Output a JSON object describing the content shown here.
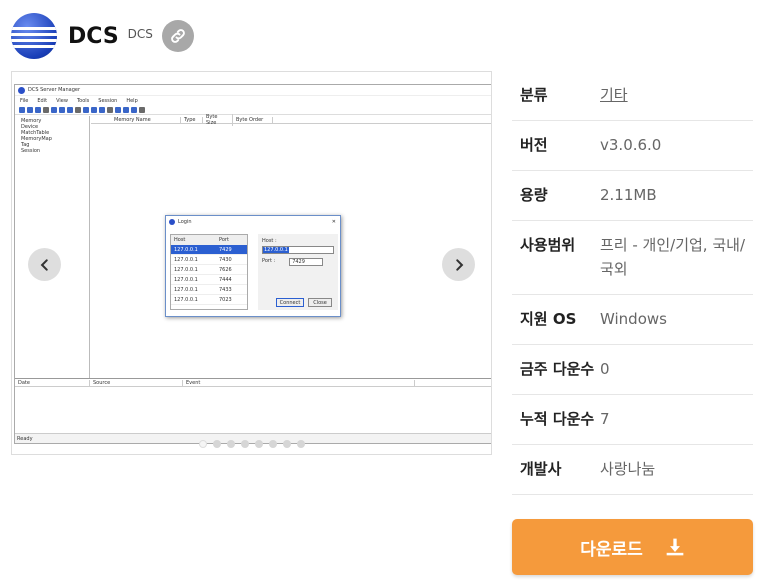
{
  "app": {
    "name": "DCS",
    "subtitle": "DCS"
  },
  "screenshot": {
    "window_title": "DCS Server Manager",
    "menu": [
      "File",
      "Edit",
      "View",
      "Tools",
      "Session",
      "Help"
    ],
    "tree": [
      "Memory",
      "Device",
      "MatchTable",
      "MemoryMap",
      "Tag",
      "Session"
    ],
    "grid_headers": [
      "Memory Name",
      "Type",
      "Byte Size",
      "Byte Order"
    ],
    "log_headers": [
      "Date",
      "Source",
      "Event"
    ],
    "status": "Ready",
    "login": {
      "title": "Login",
      "col_host": "Host",
      "col_port": "Port",
      "rows": [
        {
          "host": "127.0.0.1",
          "port": "7429"
        },
        {
          "host": "127.0.0.1",
          "port": "7430"
        },
        {
          "host": "127.0.0.1",
          "port": "7626"
        },
        {
          "host": "127.0.0.1",
          "port": "7444"
        },
        {
          "host": "127.0.0.1",
          "port": "7433"
        },
        {
          "host": "127.0.0.1",
          "port": "7023"
        }
      ],
      "host_label": "Host :",
      "host_value": "127.0.0.1",
      "port_label": "Port :",
      "port_value": "7429",
      "connect": "Connect",
      "close": "Close"
    },
    "dot_count": 8
  },
  "info": [
    {
      "label": "분류",
      "value": "기타",
      "link": true
    },
    {
      "label": "버전",
      "value": "v3.0.6.0"
    },
    {
      "label": "용량",
      "value": "2.11MB"
    },
    {
      "label": "사용범위",
      "value": "프리 - 개인/기업, 국내/국외"
    },
    {
      "label": "지원 OS",
      "value": "Windows"
    },
    {
      "label": "금주 다운수",
      "value": "0"
    },
    {
      "label": "누적 다운수",
      "value": "7"
    },
    {
      "label": "개발사",
      "value": "사랑나눔"
    }
  ],
  "download": {
    "label": "다운로드"
  },
  "colors": {
    "accent": "#f59a3c",
    "link_btn": "#a8a8a8"
  },
  "icons": {
    "link": "link-icon",
    "download": "download-icon",
    "prev": "chevron-left-icon",
    "next": "chevron-right-icon"
  }
}
